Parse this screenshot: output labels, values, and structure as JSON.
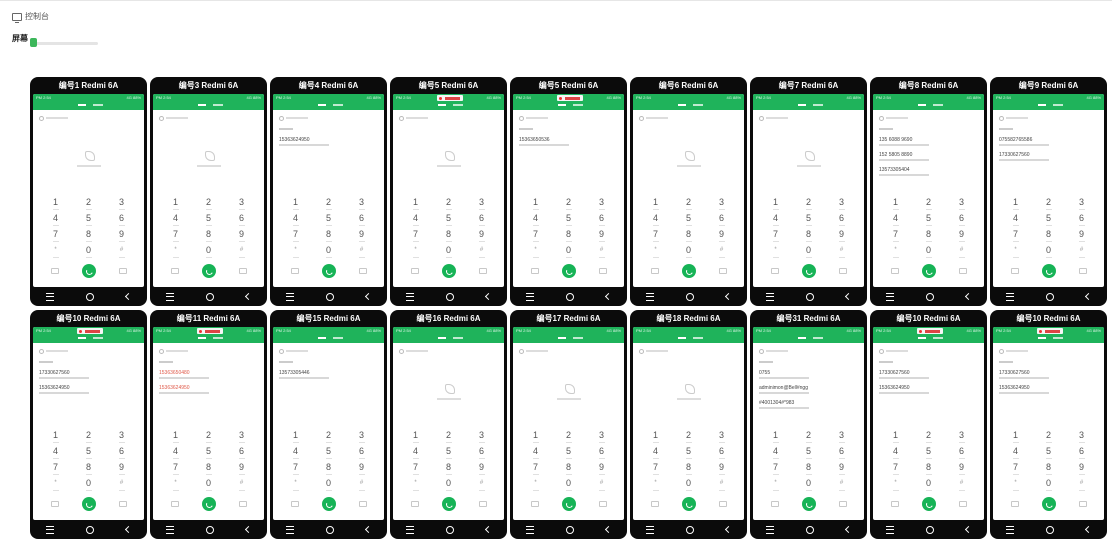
{
  "header": {
    "console_label": "控制台",
    "console_icon": "monitor-icon",
    "screen_label": "屏幕",
    "screen_slider_percent": 5
  },
  "accent_color": "#1fb35b",
  "dialer": {
    "keys": [
      "1",
      "2",
      "3",
      "4",
      "5",
      "6",
      "7",
      "8",
      "9",
      "*",
      "0",
      "#"
    ],
    "status_left": "PM 2:54",
    "status_right": "4G 88%"
  },
  "phones": [
    {
      "title": "编号1 Redmi 6A",
      "recording": false,
      "numbers": []
    },
    {
      "title": "编号3 Redmi 6A",
      "recording": false,
      "numbers": []
    },
    {
      "title": "编号4 Redmi 6A",
      "recording": false,
      "numbers": [
        "15363624950"
      ]
    },
    {
      "title": "编号5 Redmi 6A",
      "recording": true,
      "numbers": []
    },
    {
      "title": "编号5 Redmi 6A",
      "recording": true,
      "numbers": [
        "15363650536"
      ]
    },
    {
      "title": "编号6 Redmi 6A",
      "recording": false,
      "numbers": []
    },
    {
      "title": "编号7 Redmi 6A",
      "recording": false,
      "numbers": []
    },
    {
      "title": "编号8 Redmi 6A",
      "recording": false,
      "numbers": [
        "135 6088 9690",
        "152 5805 8890",
        "13573305404"
      ]
    },
    {
      "title": "编号9 Redmi 6A",
      "recording": false,
      "numbers": [
        "075582765586",
        "17330627560"
      ]
    },
    {
      "title": "编号10 Redmi 6A",
      "recording": true,
      "numbers": [
        "17330627560",
        "15363624950"
      ]
    },
    {
      "title": "编号11 Redmi 6A",
      "recording": true,
      "numbers": [
        "15363650480",
        "15363624950"
      ],
      "numbers_red": true
    },
    {
      "title": "编号15 Redmi 6A",
      "recording": false,
      "numbers": [
        "13573305446"
      ]
    },
    {
      "title": "编号16 Redmi 6A",
      "recording": false,
      "numbers": []
    },
    {
      "title": "编号17 Redmi 6A",
      "recording": false,
      "numbers": []
    },
    {
      "title": "编号18 Redmi 6A",
      "recording": false,
      "numbers": []
    },
    {
      "title": "编号31 Redmi 6A",
      "recording": false,
      "numbers": [
        "0755",
        "adminimon@Bell#ngg",
        "#4001304#*983"
      ]
    },
    {
      "title": "编号10 Redmi 6A",
      "recording": true,
      "numbers": [
        "17330627560",
        "15363624950"
      ]
    },
    {
      "title": "编号10 Redmi 6A",
      "recording": true,
      "numbers": [
        "17330627560",
        "15363624950"
      ]
    }
  ]
}
